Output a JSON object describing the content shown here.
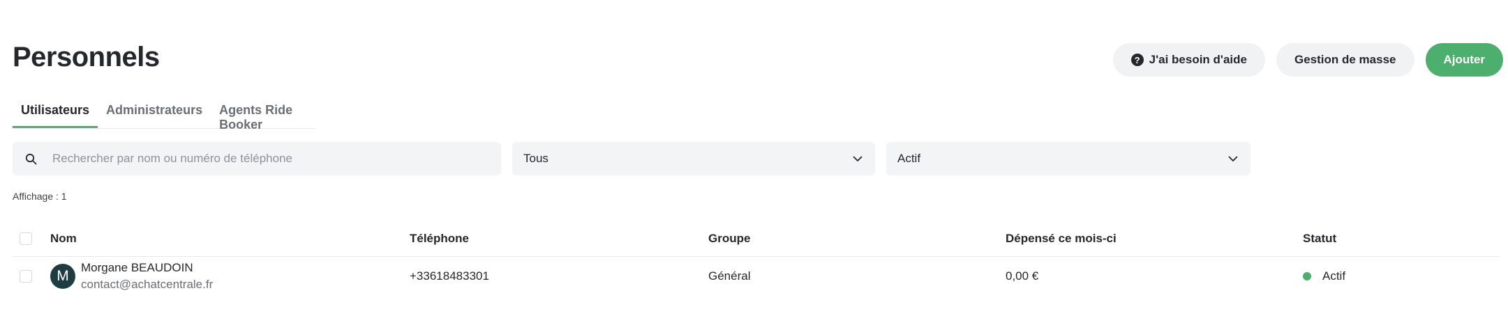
{
  "page": {
    "title": "Personnels"
  },
  "header": {
    "help_label": "J'ai besoin d'aide",
    "help_icon": "question-circle-icon",
    "bulk_label": "Gestion de masse",
    "add_label": "Ajouter",
    "accent_color": "#4caf6d"
  },
  "tabs": [
    {
      "label": "Utilisateurs",
      "active": true
    },
    {
      "label": "Administrateurs",
      "active": false
    },
    {
      "label": "Agents Ride Booker",
      "active": false
    }
  ],
  "filters": {
    "search_placeholder": "Rechercher par nom ou numéro de téléphone",
    "search_value": "",
    "group_value": "Tous",
    "status_value": "Actif"
  },
  "count_label": "Affichage : 1",
  "table": {
    "headers": {
      "name": "Nom",
      "phone": "Téléphone",
      "group": "Groupe",
      "spent": "Dépensé ce mois-ci",
      "status": "Statut"
    },
    "rows": [
      {
        "initial": "M",
        "name": "Morgane BEAUDOIN",
        "email": "contact@achatcentrale.fr",
        "phone": "+33618483301",
        "group": "Général",
        "spent": "0,00 €",
        "status": "Actif",
        "status_color": "#4caf6d"
      }
    ]
  }
}
